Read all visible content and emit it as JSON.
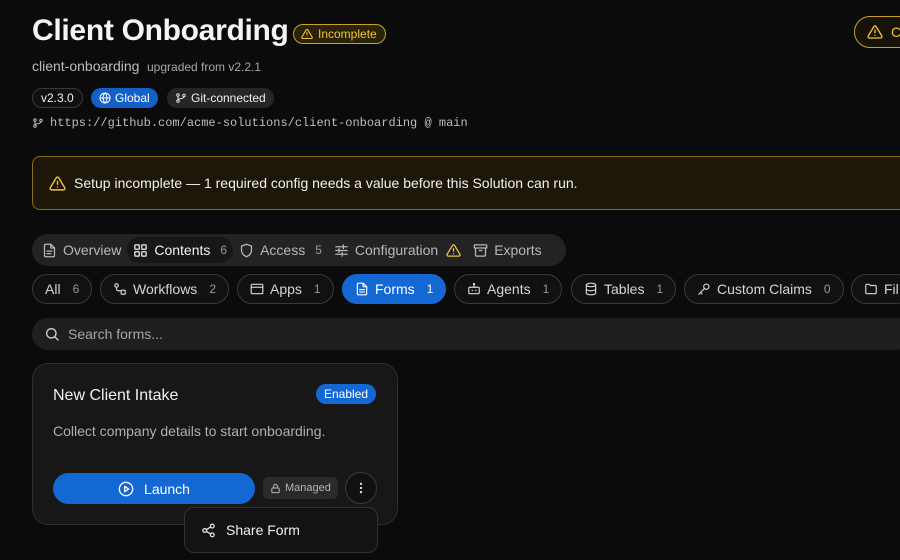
{
  "header": {
    "title": "Client Onboarding",
    "status_badge": "Incomplete",
    "slug": "client-onboarding",
    "upgraded_from": "upgraded from v2.2.1",
    "version": "v2.3.0",
    "scope": "Global",
    "source": "Git-connected",
    "repo": "https://github.com/acme-solutions/client-onboarding @ main",
    "top_right_button_partial": "C"
  },
  "alert": {
    "text": "Setup incomplete — 1 required config needs a value before this Solution can run.",
    "icon": "warning-icon"
  },
  "tabs": [
    {
      "label": "Overview",
      "icon": "document-icon",
      "count": ""
    },
    {
      "label": "Contents",
      "icon": "grid-icon",
      "count": "6",
      "active": true
    },
    {
      "label": "Access",
      "icon": "shield-icon",
      "count": "5"
    },
    {
      "label": "Configuration",
      "icon": "sliders-icon",
      "count": ""
    },
    {
      "label": "Exports",
      "icon": "archive-icon",
      "count": ""
    }
  ],
  "filters": [
    {
      "label": "All",
      "count": "6"
    },
    {
      "label": "Workflows",
      "count": "2"
    },
    {
      "label": "Apps",
      "count": "1"
    },
    {
      "label": "Forms",
      "count": "1",
      "active": true
    },
    {
      "label": "Agents",
      "count": "1"
    },
    {
      "label": "Tables",
      "count": "1"
    },
    {
      "label": "Custom Claims",
      "count": "0"
    },
    {
      "label": "Fil",
      "count": ""
    }
  ],
  "search": {
    "placeholder": "Search forms..."
  },
  "card": {
    "title": "New Client Intake",
    "status": "Enabled",
    "description": "Collect company details to start onboarding.",
    "launch_label": "Launch",
    "managed_label": "Managed"
  },
  "popover": {
    "item_label": "Share Form"
  },
  "colors": {
    "accent": "#1468d4",
    "warning": "#f0c43a",
    "background": "#0b0b0b"
  }
}
